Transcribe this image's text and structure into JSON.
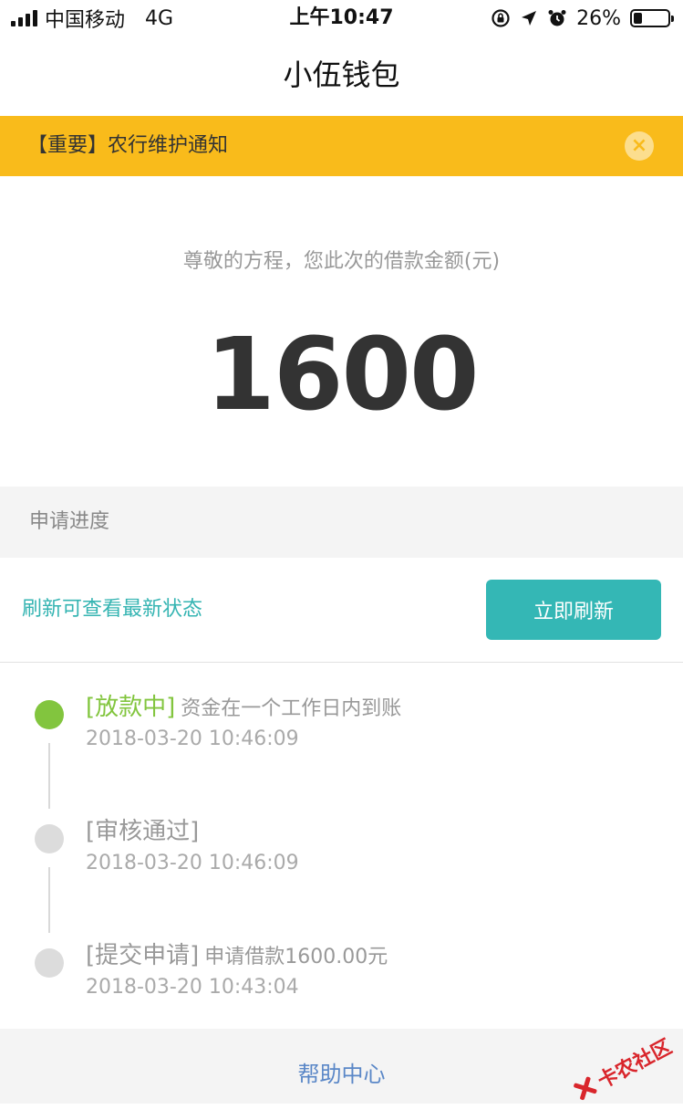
{
  "status_bar": {
    "carrier": "中国移动",
    "network": "4G",
    "time": "上午10:47",
    "battery_text": "26%",
    "battery_level": 0.26
  },
  "nav": {
    "title": "小伍钱包"
  },
  "notice": {
    "text": "【重要】农行维护通知",
    "close_icon": "×"
  },
  "amount": {
    "label": "尊敬的方程，您此次的借款金额(元)",
    "value": "1600"
  },
  "progress": {
    "section_title": "申请进度",
    "refresh_hint": "刷新可查看最新状态",
    "refresh_button": "立即刷新",
    "steps": [
      {
        "status": "[放款中]",
        "desc": "资金在一个工作日内到账",
        "time": "2018-03-20 10:46:09"
      },
      {
        "status": "[审核通过]",
        "desc": "",
        "time": "2018-03-20 10:46:09"
      },
      {
        "status": "[提交申请]",
        "desc": "申请借款1600.00元",
        "time": "2018-03-20 10:43:04"
      }
    ]
  },
  "footer": {
    "help": "帮助中心"
  },
  "watermark": {
    "text": "卡农社区"
  },
  "colors": {
    "notice_bg": "#F9BB1B",
    "accent_teal": "#34B7B5",
    "active_green": "#82C53E",
    "link_blue": "#5A87C7"
  }
}
